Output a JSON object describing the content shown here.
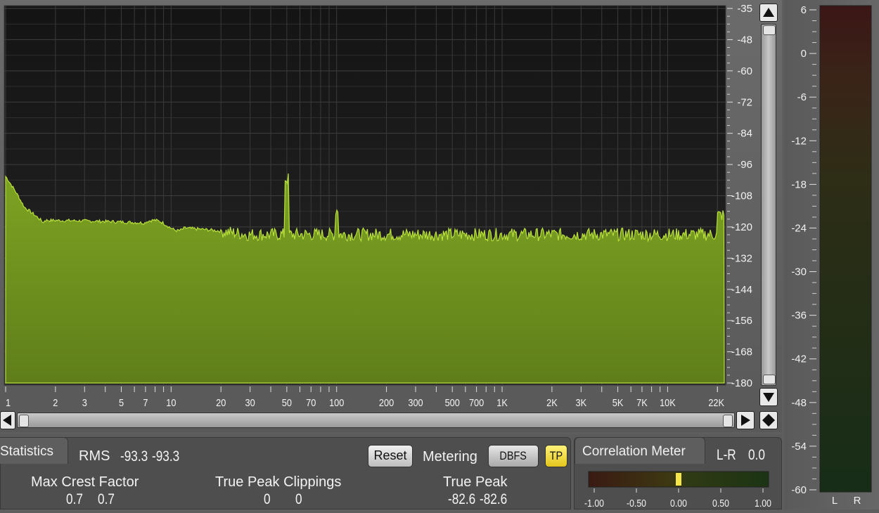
{
  "spectrum": {
    "db_scale": [
      "-35",
      "-48",
      "-60",
      "-72",
      "-84",
      "-96",
      "-108",
      "-120",
      "-132",
      "-144",
      "-156",
      "-168",
      "-180"
    ],
    "freq_labels": [
      "1",
      "2",
      "3",
      "5",
      "7",
      "10",
      "20",
      "30",
      "50",
      "70",
      "100",
      "200",
      "300",
      "500",
      "700",
      "1K",
      "2K",
      "3K",
      "5K",
      "7K",
      "10K",
      "22K"
    ],
    "colors": {
      "fill": "#6f8f1f",
      "line": "#b6dc3a",
      "bg": "#1c1c1c",
      "grid": "#4a4a4a"
    }
  },
  "scroll": {
    "up_icon": "triangle-up-icon",
    "down_icon": "triangle-down-icon",
    "left_icon": "triangle-left-icon",
    "right_icon": "triangle-right-icon",
    "reset_icon": "diamond-icon"
  },
  "statistics": {
    "tab_label": "Statistics",
    "rms_label": "RMS",
    "rms_l": "-93.3",
    "rms_r": "-93.3",
    "reset_label": "Reset",
    "metering_label": "Metering",
    "dbfs_label": "DBFS",
    "tp_label": "TP",
    "crest_label": "Max Crest Factor",
    "crest_l": "0.7",
    "crest_r": "0.7",
    "clip_label": "True Peak Clippings",
    "clip_l": "0",
    "clip_r": "0",
    "peak_label": "True Peak",
    "peak_l": "-82.6",
    "peak_r": "-82.6"
  },
  "correlation": {
    "tab_label": "Correlation Meter",
    "mode_label": "L-R",
    "mode_value": "0.0",
    "scale": [
      "-1.00",
      "-0.50",
      "0.00",
      "0.50",
      "1.00"
    ],
    "value": 0.0
  },
  "level_meter": {
    "scale": [
      "6",
      "0",
      "-6",
      "-12",
      "-18",
      "-24",
      "-30",
      "-36",
      "-42",
      "-48",
      "-54",
      "-60"
    ],
    "channels": [
      "L",
      "R"
    ]
  }
}
